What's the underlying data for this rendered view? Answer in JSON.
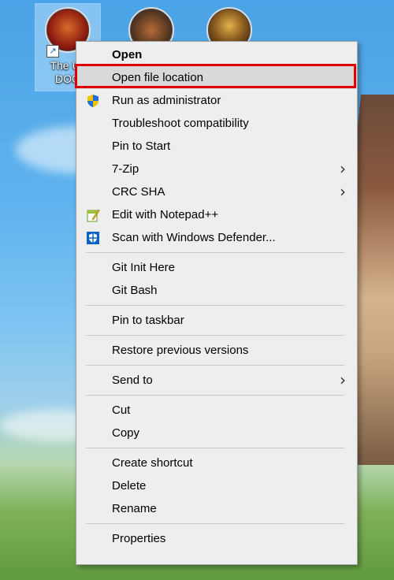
{
  "desktop": {
    "icons": [
      {
        "label_lines": [
          "The Ult",
          "DOO"
        ],
        "colors": [
          "#8b1a0f",
          "#d86a2a"
        ]
      },
      {
        "colors": [
          "#3b3b2a",
          "#b66a35"
        ]
      },
      {
        "colors": [
          "#2b1f10",
          "#c99a3a"
        ]
      }
    ]
  },
  "context_menu": {
    "items": [
      {
        "label": "Open",
        "bold": true
      },
      {
        "label": "Open file location",
        "highlighted": true
      },
      {
        "label": "Run as administrator",
        "icon": "uac-shield-icon"
      },
      {
        "label": "Troubleshoot compatibility"
      },
      {
        "label": "Pin to Start"
      },
      {
        "label": "7-Zip",
        "submenu": true
      },
      {
        "label": "CRC SHA",
        "submenu": true
      },
      {
        "label": "Edit with Notepad++",
        "icon": "notepad-plus-plus-icon"
      },
      {
        "label": "Scan with Windows Defender...",
        "icon": "windows-defender-icon"
      },
      {
        "label": "Git Init Here"
      },
      {
        "label": "Git Bash"
      },
      {
        "label": "Pin to taskbar"
      },
      {
        "label": "Restore previous versions"
      },
      {
        "label": "Send to",
        "submenu": true
      },
      {
        "label": "Cut"
      },
      {
        "label": "Copy"
      },
      {
        "label": "Create shortcut"
      },
      {
        "label": "Delete"
      },
      {
        "label": "Rename"
      },
      {
        "label": "Properties"
      }
    ],
    "highlight_color": "#e00000",
    "submenu_glyph": "›"
  }
}
